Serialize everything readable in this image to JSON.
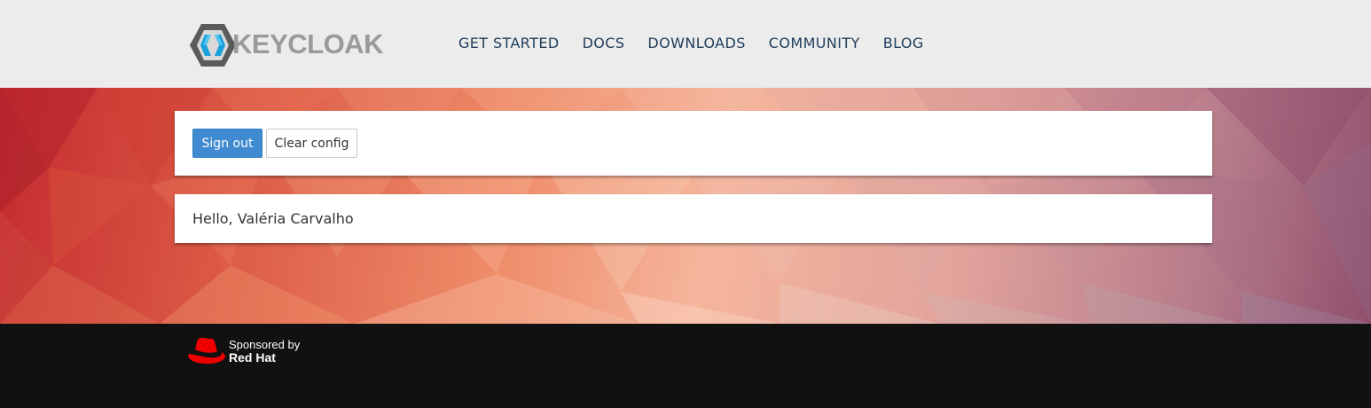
{
  "header": {
    "logo_text": "KEYCLOAK",
    "nav": [
      "GET STARTED",
      "DOCS",
      "DOWNLOADS",
      "COMMUNITY",
      "BLOG"
    ]
  },
  "actions": {
    "sign_out_label": "Sign out",
    "clear_config_label": "Clear config"
  },
  "greeting": "Hello, Valéria Carvalho",
  "footer": {
    "sponsored_by": "Sponsored by",
    "sponsor_name": "Red Hat"
  },
  "colors": {
    "primary_button": "#3f8ad0",
    "nav_text": "#1e3c5a",
    "header_bg": "#ececec",
    "footer_bg": "#111111",
    "redhat_red": "#ee0000"
  },
  "icons": [
    "keycloak-logo-icon",
    "redhat-hat-icon"
  ]
}
